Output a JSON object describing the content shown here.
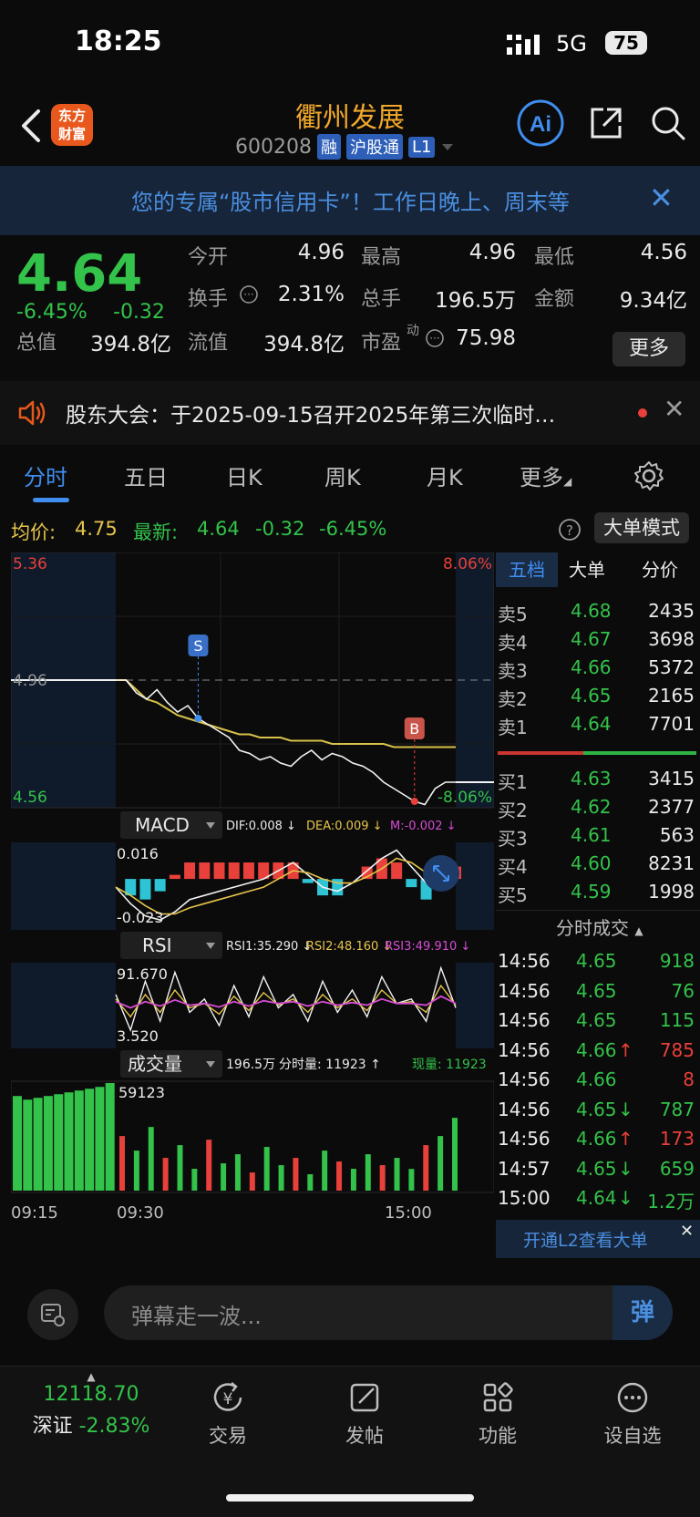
{
  "status_bar": {
    "time": "18:25",
    "network": "5G",
    "battery": "75"
  },
  "header": {
    "logo_line1": "东方",
    "logo_line2": "财富",
    "stock_name": "衢州发展",
    "stock_code": "600208",
    "badges": [
      "融",
      "沪股通",
      "L1"
    ]
  },
  "banner": {
    "text": "您的专属“股市信用卡”！工作日晚上、周末等",
    "close": "✕"
  },
  "quote": {
    "price": "4.64",
    "change_pct": "-6.45%",
    "change_abs": "-0.32",
    "fields": [
      {
        "label": "今开",
        "value": "4.96",
        "color": "white"
      },
      {
        "label": "最高",
        "value": "4.96",
        "color": "white"
      },
      {
        "label": "最低",
        "value": "4.56",
        "color": "green"
      },
      {
        "label": "换手",
        "value": "2.31%",
        "color": "white"
      },
      {
        "label": "总手",
        "value": "196.5万",
        "color": "white"
      },
      {
        "label": "金额",
        "value": "9.34亿",
        "color": "white"
      },
      {
        "label": "总值",
        "value": "394.8亿",
        "color": "white"
      },
      {
        "label": "流值",
        "value": "394.8亿",
        "color": "white"
      },
      {
        "label": "市盈",
        "value": "75.98",
        "color": "white"
      }
    ],
    "pe_superscript": "动",
    "more_button": "更多"
  },
  "notice": {
    "text": "股东大会：于2025-09-15召开2025年第三次临时…",
    "close": "✕"
  },
  "tabs": [
    "分时",
    "五日",
    "日K",
    "周K",
    "月K",
    "更多"
  ],
  "avg_row": {
    "avg_label": "均价:",
    "avg_value": "4.75",
    "latest_label": "最新:",
    "latest_value": "4.64",
    "latest_chg": "-0.32",
    "latest_pct": "-6.45%",
    "mode_button": "大单模式"
  },
  "chart_data": [
    {
      "type": "line",
      "name": "price_intraday",
      "title": "",
      "y_top_label": "5.36",
      "y_mid_label": "4.96",
      "y_bottom_label": "4.56",
      "right_top_label": "8.06%",
      "right_bottom_label": "-8.06%",
      "ylim": [
        4.56,
        5.36
      ],
      "prev_close": 4.96,
      "series": [
        {
          "name": "price",
          "values": [
            4.96,
            4.96,
            4.92,
            4.9,
            4.93,
            4.89,
            4.86,
            4.88,
            4.84,
            4.82,
            4.8,
            4.78,
            4.74,
            4.73,
            4.71,
            4.72,
            4.7,
            4.69,
            4.72,
            4.74,
            4.71,
            4.73,
            4.72,
            4.7,
            4.69,
            4.67,
            4.64,
            4.62,
            4.6,
            4.58,
            4.57,
            4.62,
            4.64,
            4.64
          ]
        },
        {
          "name": "avg",
          "values": [
            4.96,
            4.96,
            4.93,
            4.9,
            4.89,
            4.87,
            4.85,
            4.84,
            4.83,
            4.82,
            4.81,
            4.8,
            4.79,
            4.79,
            4.78,
            4.78,
            4.78,
            4.77,
            4.77,
            4.77,
            4.77,
            4.76,
            4.76,
            4.76,
            4.76,
            4.76,
            4.76,
            4.75,
            4.75,
            4.75,
            4.75,
            4.75,
            4.75,
            4.75
          ]
        }
      ],
      "markers": [
        {
          "label": "S",
          "index": 8
        },
        {
          "label": "B",
          "index": 29
        }
      ],
      "x_labels": [
        "09:15",
        "09:30",
        "15:00"
      ]
    },
    {
      "type": "line",
      "name": "macd",
      "legend": [
        "MACD",
        "DIF:0.008 ↓",
        "DEA:0.009 ↓",
        "M:-0.002 ↓"
      ],
      "y_top_label": "0.016",
      "y_bottom_label": "-0.023",
      "ylim": [
        -0.023,
        0.016
      ],
      "series": [
        {
          "name": "DIF",
          "values": [
            -0.004,
            -0.012,
            -0.018,
            -0.02,
            -0.016,
            -0.01,
            -0.008,
            -0.006,
            -0.004,
            -0.002,
            0.0,
            0.004,
            0.008,
            0.002,
            -0.004,
            -0.006,
            -0.002,
            0.004,
            0.01,
            0.014,
            0.006,
            -0.002,
            0.002,
            0.008
          ]
        },
        {
          "name": "DEA",
          "values": [
            -0.004,
            -0.008,
            -0.013,
            -0.017,
            -0.017,
            -0.014,
            -0.012,
            -0.01,
            -0.008,
            -0.006,
            -0.004,
            0.0,
            0.004,
            0.003,
            0.0,
            -0.002,
            -0.002,
            0.001,
            0.005,
            0.01,
            0.008,
            0.003,
            0.002,
            0.005
          ]
        }
      ],
      "bars": [
        0.0,
        -0.008,
        -0.01,
        -0.006,
        0.002,
        0.008,
        0.008,
        0.008,
        0.008,
        0.008,
        0.008,
        0.008,
        0.008,
        -0.002,
        -0.008,
        -0.008,
        0.0,
        0.006,
        0.01,
        0.008,
        -0.004,
        -0.01,
        0.0,
        0.006
      ]
    },
    {
      "type": "line",
      "name": "rsi",
      "legend": [
        "RSI",
        "RSI1:35.290 ↓",
        "RSI2:48.160 ↓",
        "RSI3:49.910 ↓"
      ],
      "y_top_label": "91.670",
      "y_bottom_label": "3.520",
      "ylim": [
        3.52,
        91.67
      ],
      "series": [
        {
          "name": "RSI1",
          "values": [
            60,
            20,
            75,
            30,
            85,
            40,
            55,
            25,
            70,
            35,
            80,
            45,
            60,
            30,
            75,
            40,
            65,
            35,
            80,
            50,
            55,
            30,
            90,
            45
          ]
        },
        {
          "name": "RSI2",
          "values": [
            55,
            35,
            60,
            40,
            65,
            45,
            50,
            38,
            58,
            42,
            62,
            48,
            55,
            40,
            60,
            45,
            55,
            42,
            65,
            50,
            52,
            40,
            70,
            48
          ]
        },
        {
          "name": "RSI3",
          "values": [
            52,
            45,
            52,
            47,
            54,
            48,
            50,
            46,
            52,
            47,
            53,
            50,
            52,
            47,
            52,
            48,
            51,
            48,
            55,
            50,
            50,
            48,
            58,
            50
          ]
        }
      ]
    },
    {
      "type": "bar",
      "name": "volume",
      "legend": [
        "成交量",
        "196.5万",
        "分时量: 11923 ↑",
        "现量: 11923"
      ],
      "y_top_label": "59123",
      "ylim": [
        0,
        59123
      ],
      "values": [
        52000,
        50000,
        51000,
        52000,
        53000,
        54000,
        55000,
        56000,
        57000,
        59123,
        30000,
        22000,
        35000,
        18000,
        25000,
        12000,
        28000,
        15000,
        20000,
        10000,
        24000,
        14000,
        18000,
        9000,
        22000,
        16000,
        12000,
        20000,
        14000,
        18000,
        11923,
        25000,
        30000,
        40000
      ]
    }
  ],
  "order_book": {
    "tabs": [
      "五档",
      "大单",
      "分价"
    ],
    "asks": [
      {
        "label": "卖5",
        "price": "4.68",
        "vol": "2435"
      },
      {
        "label": "卖4",
        "price": "4.67",
        "vol": "3698"
      },
      {
        "label": "卖3",
        "price": "4.66",
        "vol": "5372"
      },
      {
        "label": "卖2",
        "price": "4.65",
        "vol": "2165"
      },
      {
        "label": "卖1",
        "price": "4.64",
        "vol": "7701"
      }
    ],
    "bids": [
      {
        "label": "买1",
        "price": "4.63",
        "vol": "3415"
      },
      {
        "label": "买2",
        "price": "4.62",
        "vol": "2377"
      },
      {
        "label": "买3",
        "price": "4.61",
        "vol": "563"
      },
      {
        "label": "买4",
        "price": "4.60",
        "vol": "8231"
      },
      {
        "label": "买5",
        "price": "4.59",
        "vol": "1998"
      }
    ],
    "ticks_title": "分时成交",
    "ticks": [
      {
        "time": "14:56",
        "price": "4.65",
        "arrow": "",
        "vol": "918",
        "color": "green"
      },
      {
        "time": "14:56",
        "price": "4.65",
        "arrow": "",
        "vol": "76",
        "color": "green"
      },
      {
        "time": "14:56",
        "price": "4.65",
        "arrow": "",
        "vol": "115",
        "color": "green"
      },
      {
        "time": "14:56",
        "price": "4.66",
        "arrow": "↑",
        "vol": "785",
        "color": "red"
      },
      {
        "time": "14:56",
        "price": "4.66",
        "arrow": "",
        "vol": "8",
        "color": "red"
      },
      {
        "time": "14:56",
        "price": "4.65",
        "arrow": "↓",
        "vol": "787",
        "color": "green"
      },
      {
        "time": "14:56",
        "price": "4.66",
        "arrow": "↑",
        "vol": "173",
        "color": "red"
      },
      {
        "time": "14:57",
        "price": "4.65",
        "arrow": "↓",
        "vol": "659",
        "color": "green"
      },
      {
        "time": "15:00",
        "price": "4.64",
        "arrow": "↓",
        "vol": "1.2万",
        "color": "green"
      }
    ],
    "l2_banner": "开通L2查看大单"
  },
  "danmu": {
    "placeholder": "弹幕走一波...",
    "send": "弹"
  },
  "bottom_nav": {
    "index_value": "12118.70",
    "index_name": "深证",
    "index_pct": "-2.83%",
    "items": [
      "交易",
      "发帖",
      "功能",
      "设自选"
    ]
  },
  "colors": {
    "up": "#e8403a",
    "down": "#33c24a",
    "accent": "#3f8ef0",
    "avg_line": "#e6c44b"
  }
}
